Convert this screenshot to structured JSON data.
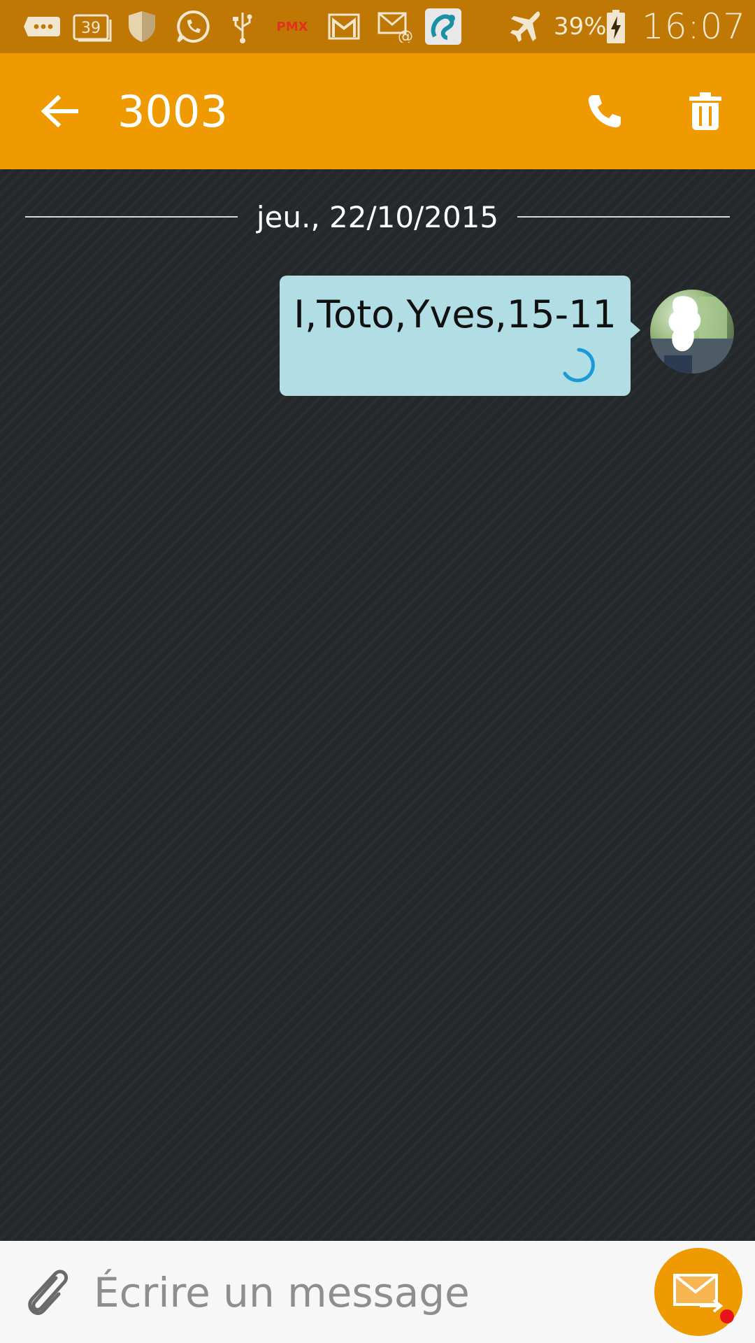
{
  "status_bar": {
    "icons": [
      "more-notifications-icon",
      "calendar-39-icon",
      "shield-icon",
      "whatsapp-icon",
      "usb-icon",
      "pmx-app-icon",
      "gmail-icon",
      "email-icon",
      "app-launcher-icon",
      "airplane-mode-icon",
      "battery-charging-icon"
    ],
    "calendar_badge": "39",
    "pmx_label": "PMX",
    "battery_percent": "39%",
    "time": "16:07"
  },
  "app_bar": {
    "title": "3003",
    "icons": [
      "back-arrow-icon",
      "phone-icon",
      "trash-icon"
    ]
  },
  "conversation": {
    "date_separator": "jeu., 22/10/2015",
    "messages": [
      {
        "text": "I,Toto,Yves,15-11",
        "direction": "outgoing",
        "status": "sending",
        "bubble_color": "#b1dde4"
      }
    ]
  },
  "compose": {
    "placeholder": "Écrire un message",
    "value": "",
    "icons": [
      "paperclip-icon",
      "send-message-icon"
    ]
  },
  "colors": {
    "status_bar": "#c07804",
    "accent": "#ee9a00",
    "background": "#25282a",
    "bubble": "#b1dde4",
    "spinner": "#1a9ad6",
    "notification_dot": "#e8121a"
  }
}
